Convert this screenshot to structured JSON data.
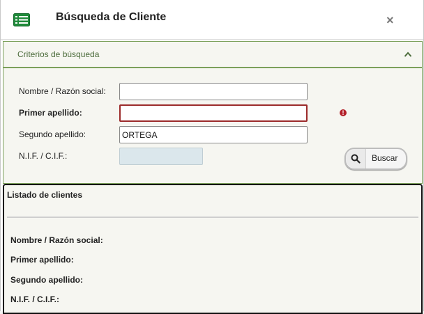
{
  "dialog": {
    "title": "Búsqueda de Cliente",
    "close_symbol": "×",
    "icon": "list-icon"
  },
  "criteria": {
    "title": "Criterios de búsqueda",
    "collapse_icon": "chevron-up-icon",
    "fields": {
      "nombre": {
        "label": "Nombre / Razón social:",
        "value": ""
      },
      "primer_apellido": {
        "label": "Primer apellido:",
        "value": "",
        "error": true
      },
      "segundo_apellido": {
        "label": "Segundo apellido:",
        "value": "ORTEGA"
      },
      "nif": {
        "label": "N.I.F. / C.I.F.:",
        "value": "",
        "disabled": true
      }
    },
    "search_button": {
      "label": "Buscar",
      "icon": "search-icon"
    },
    "error_icon": "!"
  },
  "results": {
    "title": "Listado de clientes",
    "labels": {
      "nombre": "Nombre / Razón social:",
      "primer_apellido": "Primer apellido:",
      "segundo_apellido": "Segundo apellido:",
      "nif": "N.I.F. / C.I.F.:"
    }
  },
  "colors": {
    "accent_green": "#7ba05b",
    "error_red": "#9b2a2a",
    "panel_bg": "#f6f6f1"
  }
}
